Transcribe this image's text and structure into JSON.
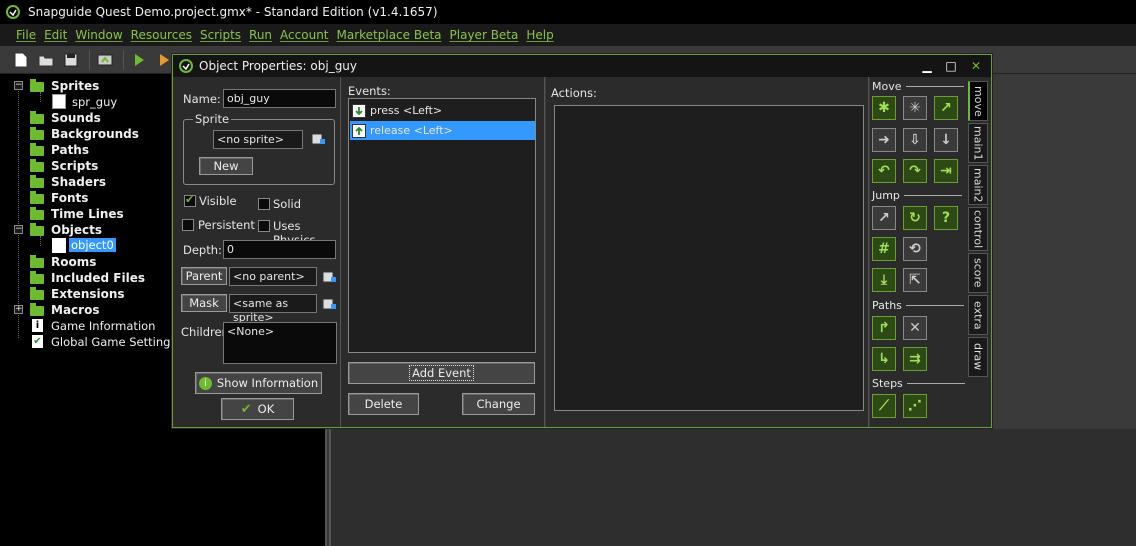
{
  "window_title": "Snapguide Quest Demo.project.gmx*  -  Standard Edition (v1.4.1657)",
  "menu": [
    "File",
    "Edit",
    "Window",
    "Resources",
    "Scripts",
    "Run",
    "Account",
    "Marketplace Beta",
    "Player Beta",
    "Help"
  ],
  "tree": {
    "sprites": "Sprites",
    "spr_guy": "spr_guy",
    "sounds": "Sounds",
    "backgrounds": "Backgrounds",
    "paths": "Paths",
    "scripts": "Scripts",
    "shaders": "Shaders",
    "fonts": "Fonts",
    "time_lines": "Time Lines",
    "objects": "Objects",
    "object0": "object0",
    "rooms": "Rooms",
    "included_files": "Included Files",
    "extensions": "Extensions",
    "macros": "Macros",
    "game_information": "Game Information",
    "global_game_settings": "Global Game Settings"
  },
  "dialog": {
    "title": "Object Properties: obj_guy",
    "name_label": "Name:",
    "name_value": "obj_guy",
    "sprite_group": "Sprite",
    "sprite_value": "<no sprite>",
    "new_button": "New",
    "visible_label": "Visible",
    "solid_label": "Solid",
    "persistent_label": "Persistent",
    "physics_label": "Uses Physics",
    "depth_label": "Depth:",
    "depth_value": "0",
    "parent_button": "Parent",
    "parent_value": "<no parent>",
    "mask_button": "Mask",
    "mask_value": "<same as sprite>",
    "children_label": "Children:",
    "children_value": "<None>",
    "show_info_button": "Show Information",
    "ok_button": "OK",
    "events_label": "Events:",
    "events": [
      "press <Left>",
      "release <Left>"
    ],
    "add_event_button": "Add Event",
    "delete_button": "Delete",
    "change_button": "Change",
    "actions_label": "Actions:",
    "sections": {
      "move": "Move",
      "jump": "Jump",
      "paths": "Paths",
      "steps": "Steps"
    },
    "tabs": [
      "move",
      "main1",
      "main2",
      "control",
      "score",
      "extra",
      "draw"
    ]
  }
}
